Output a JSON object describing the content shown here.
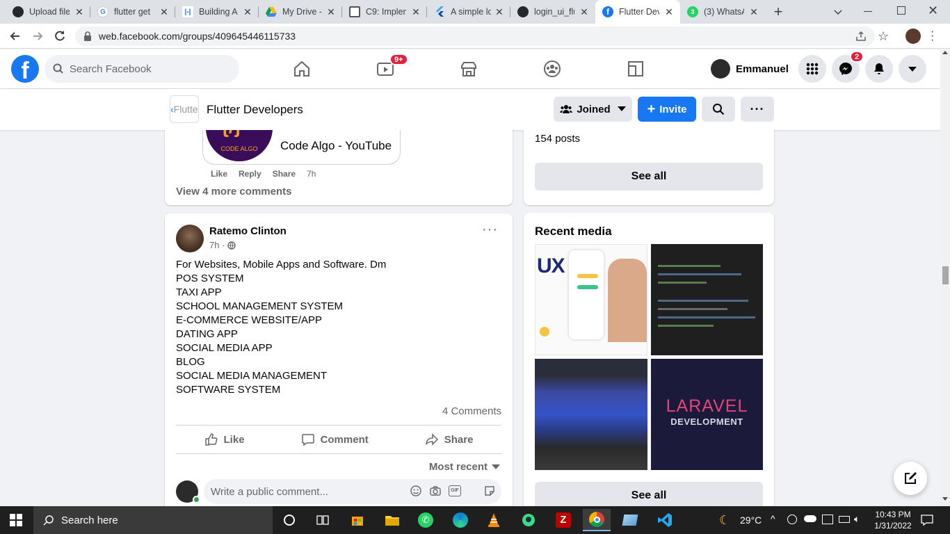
{
  "browser": {
    "tabs": [
      {
        "label": "Upload file",
        "icon": "github-icon"
      },
      {
        "label": "flutter get",
        "icon": "google-icon"
      },
      {
        "label": "Building A",
        "icon": "bracket-icon"
      },
      {
        "label": "My Drive -",
        "icon": "drive-icon"
      },
      {
        "label": "C9: Implen",
        "icon": "book-icon"
      },
      {
        "label": "A simple lo",
        "icon": "flutter-icon"
      },
      {
        "label": "login_ui_flu",
        "icon": "github-icon"
      },
      {
        "label": "Flutter Dev",
        "icon": "facebook-icon"
      },
      {
        "label": "(3) WhatsA",
        "icon": "whatsapp-icon"
      }
    ],
    "url": "web.facebook.com/groups/409645446115733"
  },
  "facebook": {
    "search_placeholder": "Search Facebook",
    "video_badge": "9+",
    "profile_name": "Emmanuel",
    "messenger_badge": "2"
  },
  "group": {
    "name": "Flutter Developers",
    "logo_text": "Flutte",
    "joined_label": "Joined",
    "invite_label": "Invite"
  },
  "prev_post": {
    "link_title": "Code Algo - YouTube",
    "thumb_text": "CODE ALGO",
    "like": "Like",
    "reply": "Reply",
    "share": "Share",
    "time": "7h",
    "view_more": "View 4 more comments"
  },
  "post": {
    "author": "Ratemo Clinton",
    "time": "7h ·",
    "lines": [
      "For Websites, Mobile Apps and Software. Dm",
      "POS SYSTEM",
      "TAXI APP",
      "SCHOOL MANAGEMENT SYSTEM",
      "E-COMMERCE WEBSITE/APP",
      "DATING APP",
      "SOCIAL MEDIA APP",
      "BLOG",
      "SOCIAL MEDIA MANAGEMENT",
      "SOFTWARE SYSTEM"
    ],
    "comments_count": "4 Comments",
    "like": "Like",
    "comment": "Comment",
    "share": "Share",
    "sort": "Most recent",
    "comment_placeholder": "Write a public comment..."
  },
  "sidebar": {
    "posts_count": "154 posts",
    "see_all": "See all",
    "recent_media_title": "Recent media",
    "see_all_2": "See all",
    "media_texts": {
      "ux": "UX",
      "laravel": "LARAVEL",
      "laravel_sub": "DEVELOPMENT"
    }
  },
  "taskbar": {
    "search_placeholder": "Search here",
    "weather": "29°C",
    "time": "10:43 PM",
    "date": "1/31/2022"
  },
  "colors": {
    "facebook_blue": "#1877f2",
    "badge_red": "#e41e3f"
  }
}
